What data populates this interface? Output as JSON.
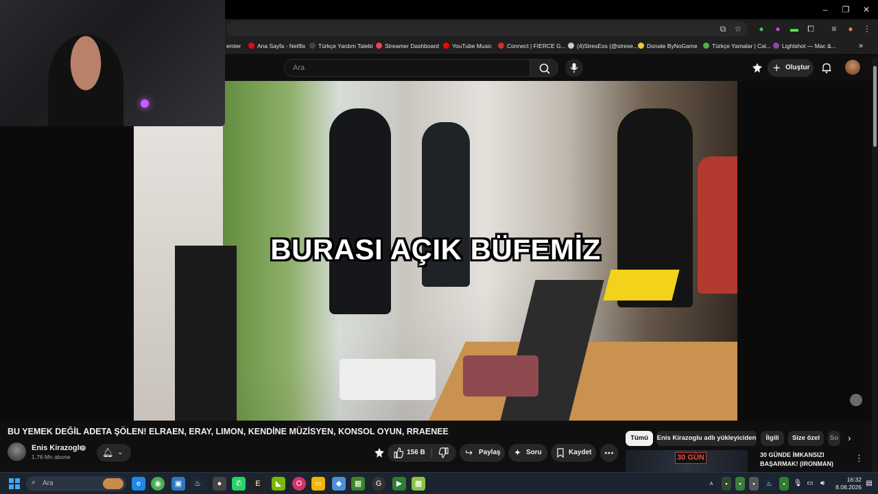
{
  "browser": {
    "window_controls": [
      "–",
      "❐",
      "✕"
    ],
    "bookmarks": [
      {
        "label": "emler",
        "color": "#888888"
      },
      {
        "label": "Ana Sayfa - Netflix",
        "color": "#e50914"
      },
      {
        "label": "Türkçe Yardım Talebi",
        "color": "#333333"
      },
      {
        "label": "Streamer Dashboard",
        "color": "#ff3b5c"
      },
      {
        "label": "YouTube Music",
        "color": "#ff0000"
      },
      {
        "label": "Connect | FIERCE G...",
        "color": "#d32f2f"
      },
      {
        "label": "(4)StresEos (@strese...",
        "color": "#cccccc"
      },
      {
        "label": "Donate ByNoGame",
        "color": "#f4c542"
      },
      {
        "label": "Türkçe Yamalar | Cal...",
        "color": "#4caf50"
      },
      {
        "label": "Lightshot — Mac &...",
        "color": "#8e44ad"
      }
    ],
    "more_bookmarks": "»"
  },
  "youtube": {
    "search_placeholder": "Ara",
    "create_label": "Oluştur",
    "video_caption": "BURASI AÇIK BÜFEMİZ",
    "video_title": "BU YEMEK DEĞİL ADETA ŞÖLEN! ELRAEN, ERAY, LIMON, KENDİNE MÜZİSYEN, KONSOL OYUN, RRAENEE",
    "channel_name": "Enis Kirazoglu",
    "channel_subs": "1,76 Mn abone",
    "likes": "156 B",
    "share_label": "Paylaş",
    "ask_label": "Soru",
    "save_label": "Kaydet",
    "chips": [
      "Tümü",
      "Enis Kirazoglu adlı yükleyiciden",
      "İlgili",
      "Size özel",
      "So"
    ],
    "reco_badge": "30 GÜN",
    "reco_title": "30 GÜNDE İMKANSIZI BAŞARMAK! (IRONMAN)"
  },
  "taskbar": {
    "search_placeholder": "Ara",
    "time": "16:32",
    "date": "8.08.2026"
  },
  "icons": {
    "windows": "windows-start-icon",
    "search": "search-icon",
    "mic": "mic-icon",
    "bell": "bell-icon",
    "like": "thumb-up-icon",
    "dislike": "thumb-down-icon"
  }
}
